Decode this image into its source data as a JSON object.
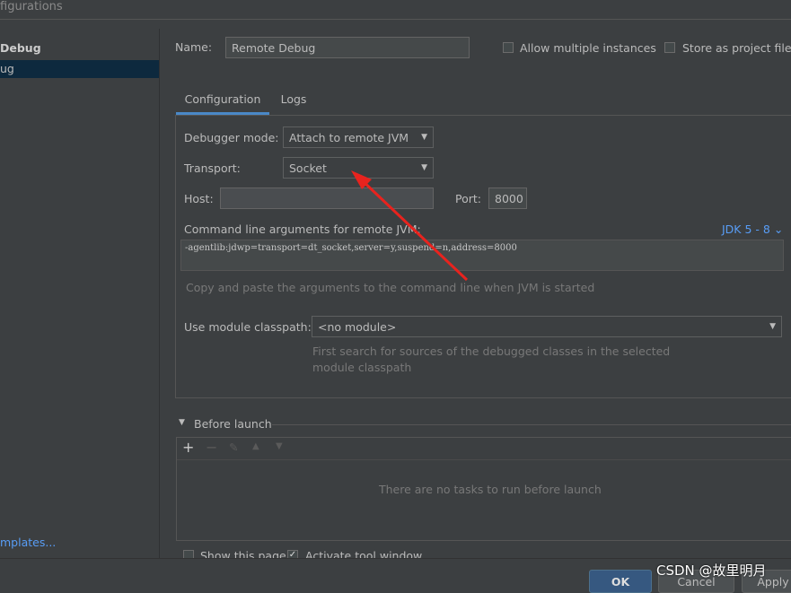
{
  "window": {
    "title": "figurations"
  },
  "sidebar": {
    "group": "Debug",
    "selected": "ug",
    "templates_link": "mplates..."
  },
  "name": {
    "label": "Name:",
    "value": "Remote Debug"
  },
  "options": {
    "allow_multiple": "Allow multiple instances",
    "store_project": "Store as project file"
  },
  "tabs": [
    {
      "label": "Configuration",
      "active": true
    },
    {
      "label": "Logs",
      "active": false
    }
  ],
  "config": {
    "debugger_mode_label": "Debugger mode:",
    "debugger_mode": "Attach to remote JVM",
    "transport_label": "Transport:",
    "transport": "Socket",
    "host_label": "Host:",
    "host": "",
    "port_label": "Port:",
    "port": "8000",
    "cmd_label": "Command line arguments for remote JVM:",
    "jdk": "JDK 5 - 8",
    "cmd_value": "-agentlib:jdwp=transport=dt_socket,server=y,suspend=n,address=8000",
    "cmd_hint": "Copy and paste the arguments to the command line when JVM is started",
    "module_label": "Use module classpath:",
    "module": "<no module>",
    "module_hint_1": "First search for sources of the debugged classes in the selected",
    "module_hint_2": "module classpath"
  },
  "before_launch": {
    "title": "Before launch",
    "empty": "There are no tasks to run before launch",
    "show_page": "Show this page",
    "activate_tool": "Activate tool window",
    "show_page_checked": false,
    "activate_checked": true
  },
  "buttons": {
    "ok": "OK",
    "cancel": "Cancel",
    "apply": "Apply"
  },
  "watermark": "CSDN @故里明月",
  "colors": {
    "accent": "#4a88c7",
    "selection": "#0d293e",
    "arrow": "#e8231e"
  }
}
